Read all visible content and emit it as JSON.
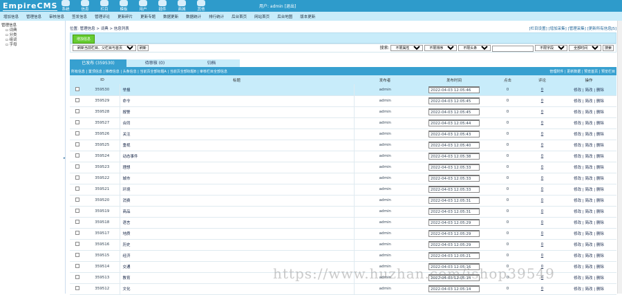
{
  "header": {
    "logo": "EmpireCMS",
    "nav": [
      "系统",
      "信息",
      "栏目",
      "模板",
      "用户",
      "插件",
      "商城",
      "其他"
    ],
    "user": "用户: admin [退出]"
  },
  "menu": [
    "增加信息",
    "管理信息",
    "审核信息",
    "签发信息",
    "管理评论",
    "更新碎片",
    "更新专题",
    "数据更新",
    "数据统计",
    "排行统计",
    "后台首页",
    "网站首页",
    "后台地图",
    "版本更新"
  ],
  "sidebar": {
    "title": "管理信息",
    "items": [
      "词典",
      "分类",
      "组词",
      "字母"
    ]
  },
  "crumb": {
    "text": "位置: 管理信息 > 词典 > 信息列表",
    "links": "[栏目设置] [增加采集] [管理采集] [更新所有信息JS]"
  },
  "toolbar": {
    "add": "增加信息",
    "refresh_select": "刷新当前栏目、父栏目与首页",
    "refresh_btn": "刷新",
    "search_label": "搜索:",
    "sel1": "不限属性",
    "sel2": "不限排序",
    "sel3": "不限头条",
    "search_value": "",
    "sel4": "不限字段",
    "sel5": "全部时间",
    "search_btn": "搜索"
  },
  "tabs": [
    "已发布 (359530)",
    "待审核 (0)",
    "归档"
  ],
  "bar_left": "所有信息 | 置顶信息 | 推荐信息 | 头条信息 | 当前页全部标题A | 当前页全部标题B | 审核栏目全部信息",
  "bar_right": "管理附件 | 更新数据 | 预览首页 | 预览栏目",
  "columns": [
    "",
    "ID",
    "标题",
    "发布者",
    "发布时间",
    "点击",
    "评论",
    "操作"
  ],
  "rows": [
    [
      "359530",
      "举报",
      "2022-04-03 12:05:46"
    ],
    [
      "359529",
      "命令",
      "2022-04-03 12:05:45"
    ],
    [
      "359528",
      "报警",
      "2022-04-03 12:05:45"
    ],
    [
      "359527",
      "合同",
      "2022-04-03 12:05:44"
    ],
    [
      "359526",
      "关注",
      "2022-04-03 12:05:43"
    ],
    [
      "359525",
      "重视",
      "2022-04-03 12:05:40"
    ],
    [
      "359524",
      "动态事件",
      "2022-04-03 12:05:38"
    ],
    [
      "359523",
      "理想",
      "2022-04-03 12:05:33"
    ],
    [
      "359522",
      "城市",
      "2022-04-03 12:05:33"
    ],
    [
      "359521",
      "环境",
      "2022-04-03 12:05:33"
    ],
    [
      "359520",
      "消费",
      "2022-04-03 12:05:31"
    ],
    [
      "359519",
      "商品",
      "2022-04-03 12:05:31"
    ],
    [
      "359518",
      "语言",
      "2022-04-03 12:05:29"
    ],
    [
      "359517",
      "地质",
      "2022-04-03 12:05:29"
    ],
    [
      "359516",
      "历史",
      "2022-04-03 12:05:29"
    ],
    [
      "359515",
      "经济",
      "2022-04-03 12:05:21"
    ],
    [
      "359514",
      "交通",
      "2022-04-03 12:05:16"
    ],
    [
      "359513",
      "教育",
      "2022-04-03 12:05:14"
    ],
    [
      "359512",
      "文化",
      "2022-04-03 12:05:14"
    ]
  ],
  "row_common": {
    "author": "admin",
    "clicks": "0",
    "comments": "0",
    "ops": "修改 | 简改 | 删除"
  },
  "watermark": "https://www.huzhan.com/ishop39549"
}
